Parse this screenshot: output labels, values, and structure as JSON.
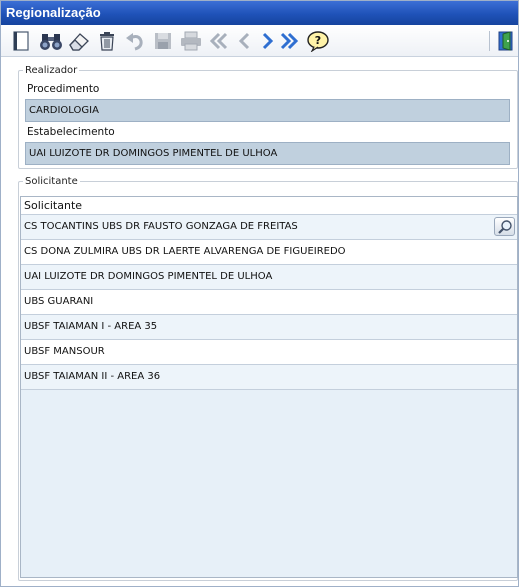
{
  "window": {
    "title": "Regionalização"
  },
  "toolbar": {
    "buttons": [
      {
        "name": "new-icon"
      },
      {
        "name": "binoculars-search-icon"
      },
      {
        "name": "eraser-icon"
      },
      {
        "name": "trash-icon"
      },
      {
        "name": "undo-icon"
      },
      {
        "name": "save-icon"
      },
      {
        "name": "print-icon"
      },
      {
        "name": "first-record-icon"
      },
      {
        "name": "previous-record-icon"
      },
      {
        "name": "next-record-icon"
      },
      {
        "name": "last-record-icon"
      },
      {
        "name": "help-icon"
      },
      {
        "name": "exit-door-icon"
      }
    ]
  },
  "realizador": {
    "legend": "Realizador",
    "procedimento_label": "Procedimento",
    "procedimento_value": "CARDIOLOGIA",
    "estabelecimento_label": "Estabelecimento",
    "estabelecimento_value": "UAI LUIZOTE DR DOMINGOS PIMENTEL DE ULHOA"
  },
  "solicitante": {
    "legend": "Solicitante",
    "column_header": "Solicitante",
    "rows": [
      "CS TOCANTINS UBS DR FAUSTO GONZAGA DE FREITAS",
      "CS DONA ZULMIRA UBS DR LAERTE ALVARENGA DE FIGUEIREDO",
      "UAI LUIZOTE DR DOMINGOS PIMENTEL DE ULHOA",
      "UBS GUARANI",
      "UBSF TAIAMAN I - AREA 35",
      "UBSF MANSOUR",
      "UBSF TAIAMAN II - AREA 36"
    ]
  },
  "colors": {
    "title_bar": "#1f52b8",
    "field_bg": "#c0d0de",
    "grid_bg": "#e7f0f8"
  }
}
